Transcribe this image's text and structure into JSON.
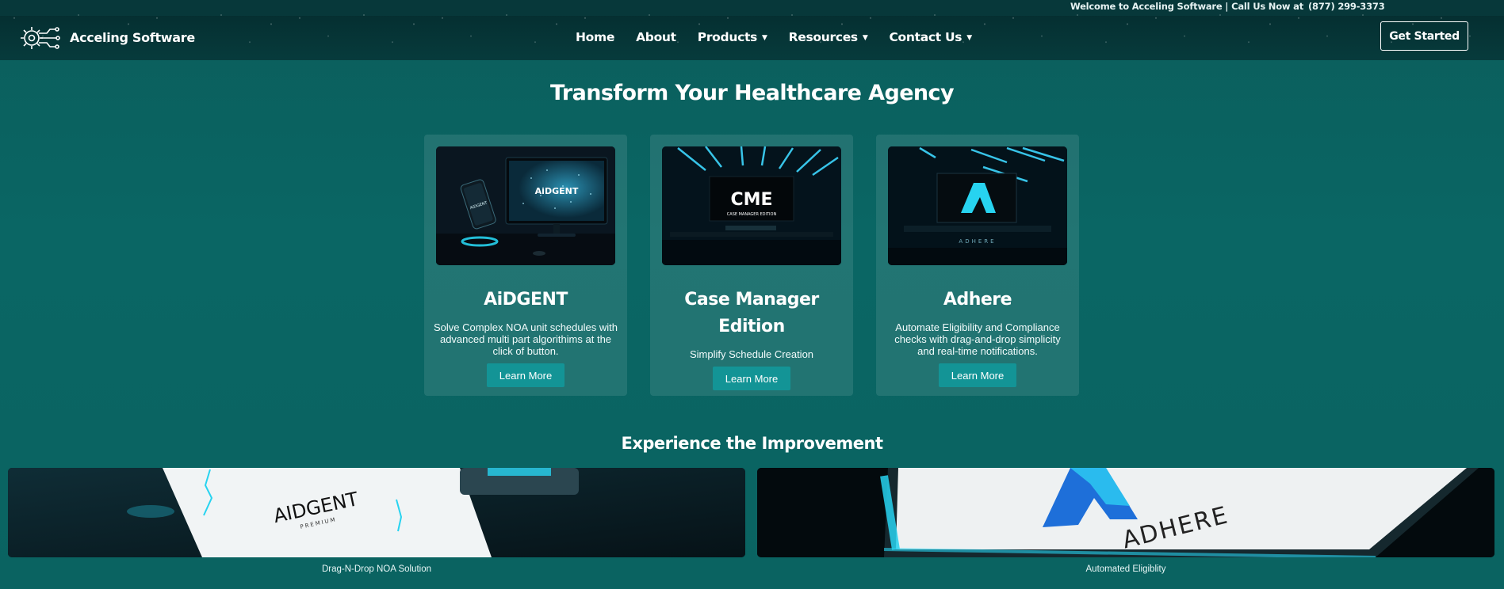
{
  "topbar": {
    "message": "Welcome to Acceling Software | Call Us Now at",
    "phone": "(877) 299-3373"
  },
  "header": {
    "brand": "Acceling Software",
    "logo_icon": "gear-circuit-icon",
    "nav": [
      {
        "label": "Home",
        "dropdown": false
      },
      {
        "label": "About",
        "dropdown": false
      },
      {
        "label": "Products",
        "dropdown": true
      },
      {
        "label": "Resources",
        "dropdown": true
      },
      {
        "label": "Contact Us",
        "dropdown": true
      }
    ],
    "cta_label": "Get Started"
  },
  "main": {
    "heading": "Transform Your Healthcare Agency",
    "products": [
      {
        "title": "AiDGENT",
        "description": "Solve Complex NOA unit schedules with advanced multi part algorithims at the click of button.",
        "button": "Learn More",
        "image_text": "AiDGENT"
      },
      {
        "title": "Case Manager Edition",
        "description": "Simplify Schedule Creation",
        "button": "Learn More",
        "image_text": "CME",
        "image_subtext": "CASE MANAGER EDITION"
      },
      {
        "title": "Adhere",
        "description": "Automate Eligibility and Compliance checks with drag-and-drop simplicity and real-time notifications.",
        "button": "Learn More",
        "image_text": "ADHERE"
      }
    ],
    "improvement_heading": "Experience the Improvement",
    "banners": [
      {
        "caption": "Drag-N-Drop NOA Solution",
        "image_text": "AIDGENT",
        "image_subtext": "PREMIUM"
      },
      {
        "caption": "Automated Eligiblity",
        "image_text": "ADHERE"
      }
    ]
  },
  "colors": {
    "background": "#0a6664",
    "header": "#063b3c",
    "accent_button": "#139496",
    "glow": "#27d3f0"
  }
}
